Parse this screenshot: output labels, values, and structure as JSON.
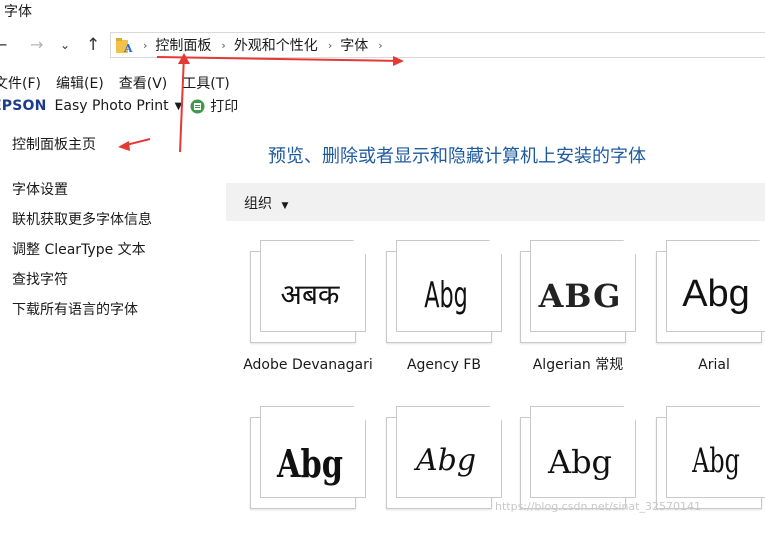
{
  "window": {
    "title": "字体"
  },
  "nav": {
    "back": "←",
    "forward": "→",
    "recent": "⌄",
    "up": "↑",
    "breadcrumbs": [
      "控制面板",
      "外观和个性化",
      "字体"
    ],
    "separator": "›"
  },
  "menu": [
    "文件(F)",
    "编辑(E)",
    "查看(V)",
    "工具(T)"
  ],
  "toolbar": {
    "brand": "EPSON",
    "epson_app": "Easy Photo Print",
    "print": "打印"
  },
  "sidebar": {
    "home": "控制面板主页",
    "links": [
      "字体设置",
      "联机获取更多字体信息",
      "调整 ClearType 文本",
      "查找字符",
      "下载所有语言的字体"
    ]
  },
  "main": {
    "heading": "预览、删除或者显示和隐藏计算机上安装的字体",
    "organize": "组织",
    "fonts": [
      {
        "name": "Adobe Devanagari",
        "sample": "अबक"
      },
      {
        "name": "Agency FB",
        "sample": "Abg"
      },
      {
        "name": "Algerian 常规",
        "sample": "ABG"
      },
      {
        "name": "Arial",
        "sample": "Abg"
      },
      {
        "name": "",
        "sample": "Abg"
      },
      {
        "name": "",
        "sample": "Abg"
      },
      {
        "name": "",
        "sample": "Abg"
      },
      {
        "name": "",
        "sample": "Abg"
      }
    ]
  },
  "watermark": "https://blog.csdn.net/sinat_32570141",
  "annotation_color": "#e53935"
}
